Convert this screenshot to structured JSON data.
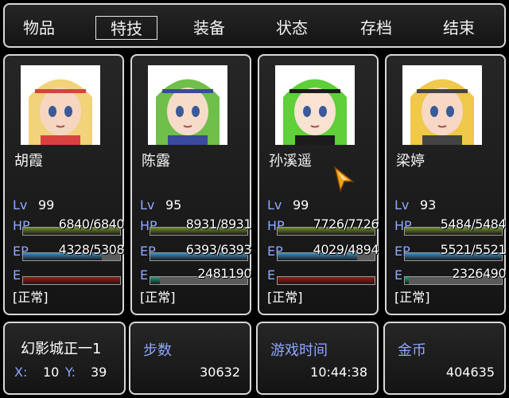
{
  "menu": {
    "items": [
      "物品",
      "特技",
      "装备",
      "状态",
      "存档",
      "结束"
    ],
    "selected_index": 1
  },
  "party": [
    {
      "name": "胡霞",
      "lv_label": "Lv",
      "lv": "99",
      "hp_label": "HP",
      "hp": "6840/6840",
      "hp_fraction": 1.0,
      "ep_label": "EP",
      "ep": "4328/5308",
      "ep_fraction": 0.815,
      "e_label": "E",
      "e_fraction": 1.0,
      "e_color": "#b01010",
      "status": "[正常]",
      "hair": "#f2d27a",
      "accent": "#d94040",
      "skin": "#f6d6c0"
    },
    {
      "name": "陈露",
      "lv_label": "Lv",
      "lv": "95",
      "hp_label": "HP",
      "hp": "8931/8931",
      "hp_fraction": 1.0,
      "ep_label": "EP",
      "ep": "6393/6393",
      "ep_fraction": 1.0,
      "e_label": "E",
      "e": "2481190",
      "e_fraction": 0.1,
      "e_color": "#1aa37a",
      "status": "[正常]",
      "hair": "#6fbf4a",
      "accent": "#3a4a9c",
      "skin": "#f6dcc8"
    },
    {
      "name": "孙溪遥",
      "lv_label": "Lv",
      "lv": "99",
      "hp_label": "HP",
      "hp": "7726/7726",
      "hp_fraction": 1.0,
      "ep_label": "EP",
      "ep": "4029/4894",
      "ep_fraction": 0.823,
      "e_label": "E",
      "e_fraction": 1.0,
      "e_color": "#b01010",
      "status": "[正常]",
      "hair": "#5fcf3a",
      "accent": "#1c1c1c",
      "skin": "#f8e2d2"
    },
    {
      "name": "梁婷",
      "lv_label": "Lv",
      "lv": "93",
      "hp_label": "HP",
      "hp": "5484/5484",
      "hp_fraction": 1.0,
      "ep_label": "EP",
      "ep": "5521/5521",
      "ep_fraction": 1.0,
      "e_label": "E",
      "e": "2326490",
      "e_fraction": 0.04,
      "e_color": "#1aa37a",
      "status": "[正常]",
      "hair": "#f0c84a",
      "accent": "#444444",
      "skin": "#f6d8c4"
    }
  ],
  "location": {
    "name": "幻影城正一1",
    "x_label": "X:",
    "x": "10",
    "y_label": "Y:",
    "y": "39"
  },
  "steps": {
    "label": "步数",
    "value": "30632"
  },
  "playtime": {
    "label": "游戏时间",
    "value": "10:44:38"
  },
  "gold": {
    "label": "金币",
    "value": "404635"
  },
  "colors": {
    "label_blue": "#8fa8ff",
    "hp_bar": "#6f8f2a",
    "ep_bar": "#3a8fc0",
    "cursor": "#f0a020"
  }
}
